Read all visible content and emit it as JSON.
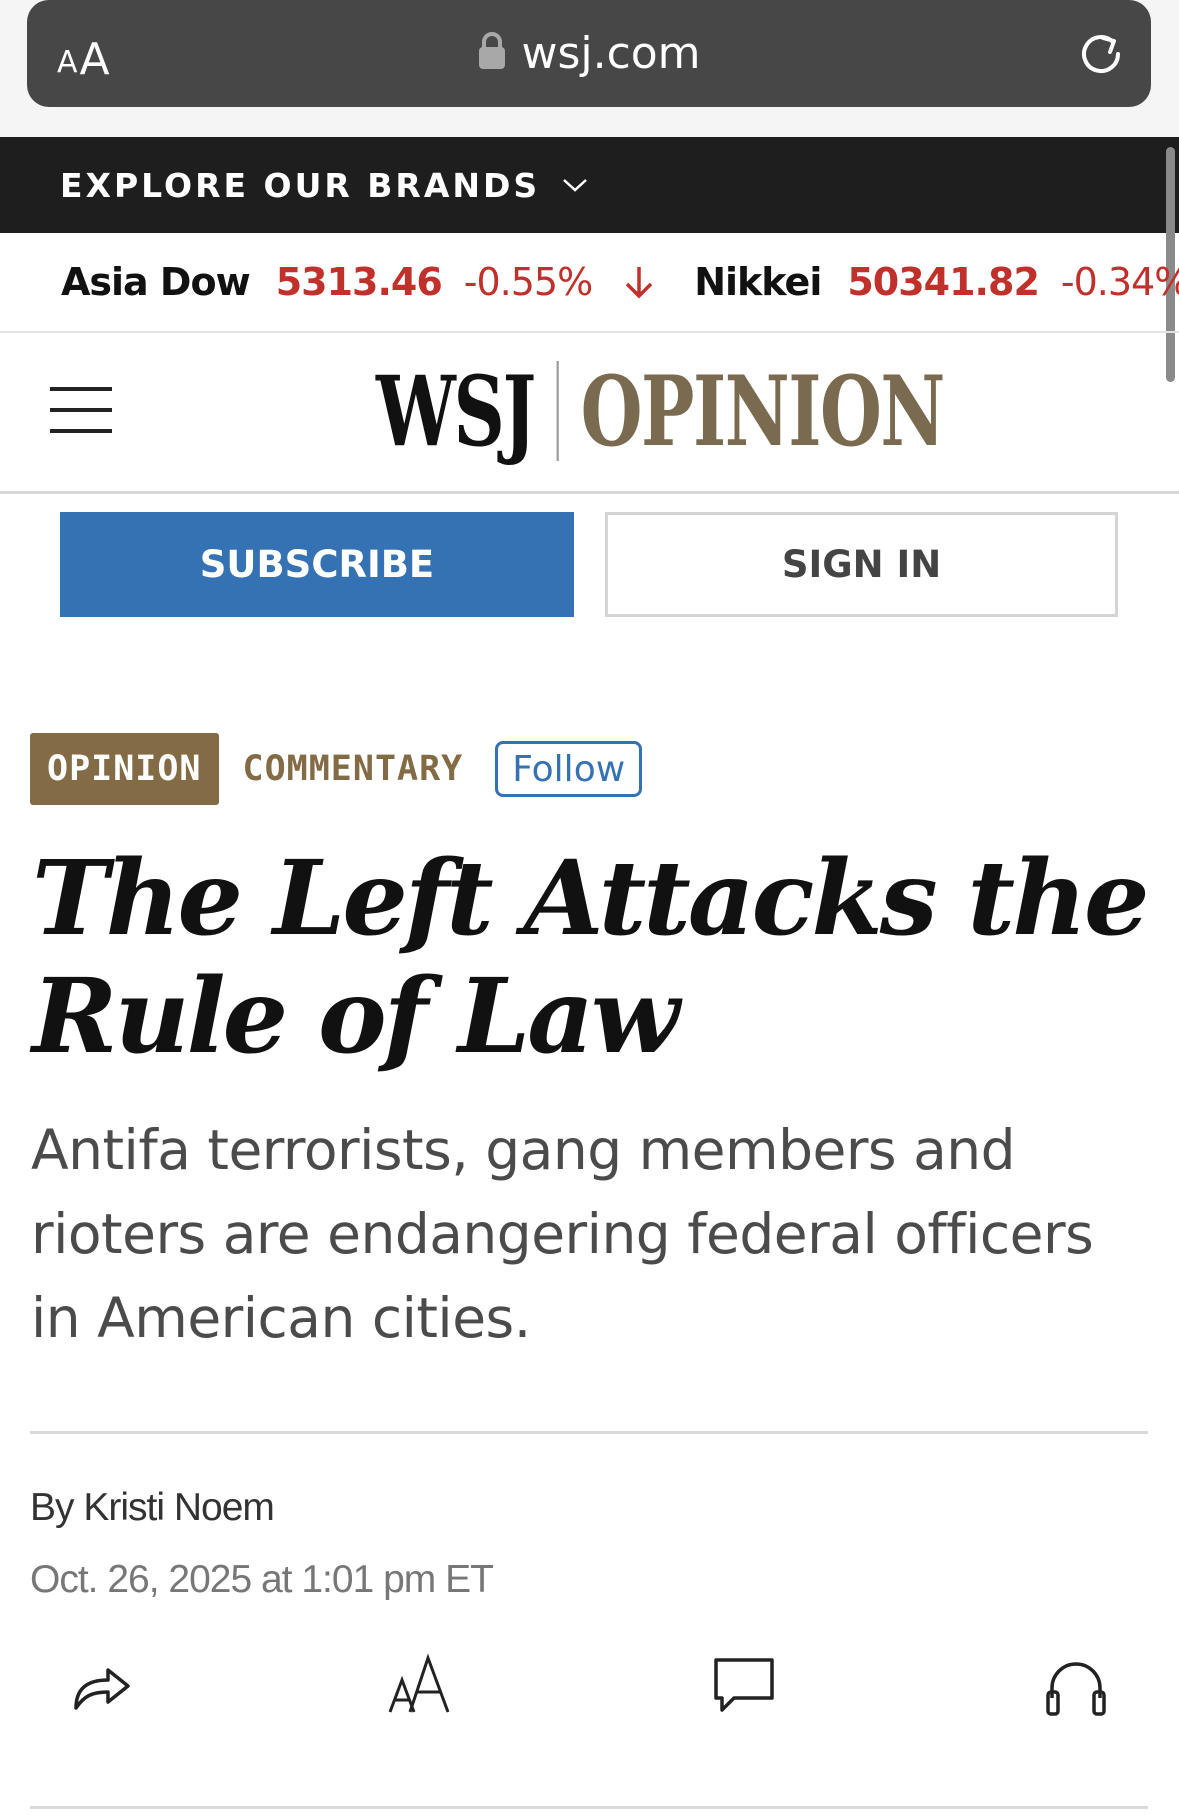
{
  "browser": {
    "text_size_small": "A",
    "text_size_large": "A",
    "url": "wsj.com"
  },
  "brands_bar": {
    "label": "EXPLORE OUR BRANDS"
  },
  "ticker": [
    {
      "name": "Asia Dow",
      "value": "5313.46",
      "change": "-0.55%",
      "direction": "down"
    },
    {
      "name": "Nikkei",
      "value": "50341.82",
      "change": "-0.34%",
      "direction": "down"
    }
  ],
  "masthead": {
    "logo": "WSJ",
    "section": "OPINION"
  },
  "auth": {
    "subscribe_label": "SUBSCRIBE",
    "signin_label": "SIGN IN"
  },
  "article": {
    "section_badge": "OPINION",
    "category": "COMMENTARY",
    "follow_label": "Follow",
    "headline": "The Left Attacks the Rule of Law",
    "dek": "Antifa terrorists, gang members and rioters are endangering federal officers in American cities.",
    "byline": "By Kristi Noem",
    "dateline": "Oct. 26, 2025 at 1:01 pm ET"
  },
  "toolbar": {
    "share_icon": "share-icon",
    "text_size_icon": "text-size-icon",
    "comments_icon": "comment-icon",
    "listen_icon": "headphones-icon"
  },
  "colors": {
    "subscribe": "#3572b4",
    "opinion_brown": "#836b46",
    "ticker_red": "#c0312b",
    "brands_bar": "#1e1e1e"
  }
}
